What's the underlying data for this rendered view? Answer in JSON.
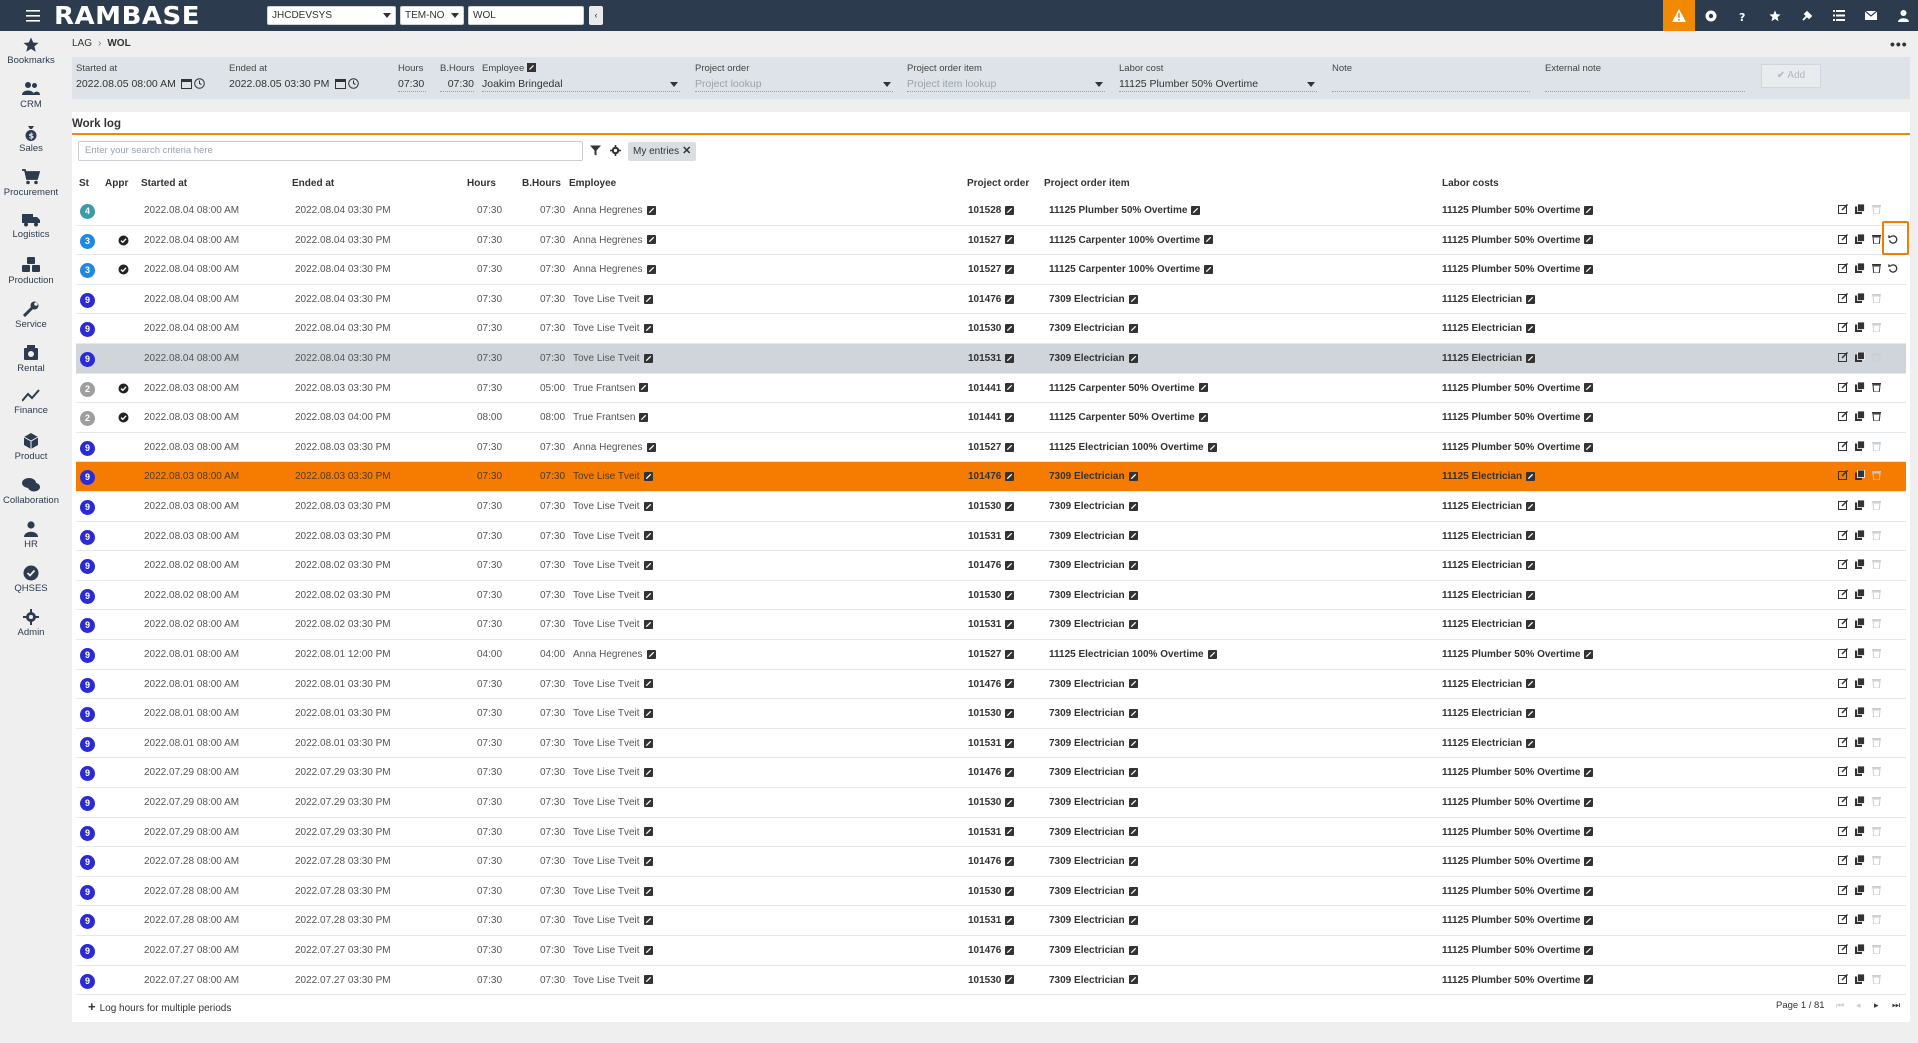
{
  "topbar": {
    "logo": "RAMBASE",
    "database": "JHCDEVSYS",
    "company": "TEM-NO",
    "search_value": "WOL",
    "icons": [
      "alert-icon",
      "support-icon",
      "help-icon",
      "star-icon",
      "pin-icon",
      "list-icon",
      "mail-icon",
      "user-icon"
    ],
    "accent": "#f18a00",
    "bar_color": "#2d3b4e"
  },
  "sidenav": [
    {
      "label": "Bookmarks",
      "icon": "star-icon"
    },
    {
      "label": "CRM",
      "icon": "people-icon"
    },
    {
      "label": "Sales",
      "icon": "moneybag-icon"
    },
    {
      "label": "Procurement",
      "icon": "cart-icon"
    },
    {
      "label": "Logistics",
      "icon": "truck-icon"
    },
    {
      "label": "Production",
      "icon": "boxes-icon"
    },
    {
      "label": "Service",
      "icon": "wrench-icon"
    },
    {
      "label": "Rental",
      "icon": "rental-icon"
    },
    {
      "label": "Finance",
      "icon": "chart-icon"
    },
    {
      "label": "Product",
      "icon": "cube-icon"
    },
    {
      "label": "Collaboration",
      "icon": "chat-icon"
    },
    {
      "label": "HR",
      "icon": "person-icon"
    },
    {
      "label": "QHSES",
      "icon": "check-badge-icon"
    },
    {
      "label": "Admin",
      "icon": "gear-icon"
    }
  ],
  "breadcrumb": {
    "root": "LAG",
    "current": "WOL"
  },
  "entry": {
    "started_label": "Started at",
    "started_value": "2022.08.05 08:00 AM",
    "ended_label": "Ended at",
    "ended_value": "2022.08.05 03:30 PM",
    "hours_label": "Hours",
    "hours_value": "07:30",
    "bhours_label": "B.Hours",
    "bhours_value": "07:30",
    "employee_label": "Employee",
    "employee_value": "Joakim Bringedal",
    "project_order_label": "Project order",
    "project_order_placeholder": "Project lookup",
    "project_item_label": "Project order item",
    "project_item_placeholder": "Project item lookup",
    "labor_label": "Labor cost",
    "labor_value": "11125 Plumber 50% Overtime",
    "note_label": "Note",
    "ext_note_label": "External note",
    "add_label": "✔ Add"
  },
  "worklog": {
    "title": "Work log",
    "search_placeholder": "Enter your search criteria here",
    "chip_label": "My entries",
    "columns": {
      "st": "St",
      "appr": "Appr",
      "started": "Started at",
      "ended": "Ended at",
      "hours": "Hours",
      "bhours": "B.Hours",
      "employee": "Employee",
      "project_order": "Project order",
      "project_item": "Project order item",
      "labor": "Labor costs"
    },
    "rows": [
      {
        "st": "4",
        "appr": false,
        "started": "2022.08.04 08:00 AM",
        "ended": "2022.08.04 03:30 PM",
        "hours": "07:30",
        "bhours": "07:30",
        "employee": "Anna Hegrenes",
        "po": "101528",
        "item": "11125 Plumber 50% Overtime",
        "labor": "11125 Plumber 50% Overtime",
        "del": false,
        "undo": false,
        "style": ""
      },
      {
        "st": "3",
        "appr": true,
        "started": "2022.08.04 08:00 AM",
        "ended": "2022.08.04 03:30 PM",
        "hours": "07:30",
        "bhours": "07:30",
        "employee": "Anna Hegrenes",
        "po": "101527",
        "item": "11125 Carpenter 100% Overtime",
        "labor": "11125 Plumber 50% Overtime",
        "del": true,
        "undo": true,
        "style": ""
      },
      {
        "st": "3",
        "appr": true,
        "started": "2022.08.04 08:00 AM",
        "ended": "2022.08.04 03:30 PM",
        "hours": "07:30",
        "bhours": "07:30",
        "employee": "Anna Hegrenes",
        "po": "101527",
        "item": "11125 Carpenter 100% Overtime",
        "labor": "11125 Plumber 50% Overtime",
        "del": true,
        "undo": true,
        "style": ""
      },
      {
        "st": "9",
        "appr": false,
        "started": "2022.08.04 08:00 AM",
        "ended": "2022.08.04 03:30 PM",
        "hours": "07:30",
        "bhours": "07:30",
        "employee": "Tove Lise Tveit",
        "po": "101476",
        "item": "7309 Electrician",
        "labor": "11125 Electrician",
        "del": false,
        "undo": false,
        "style": ""
      },
      {
        "st": "9",
        "appr": false,
        "started": "2022.08.04 08:00 AM",
        "ended": "2022.08.04 03:30 PM",
        "hours": "07:30",
        "bhours": "07:30",
        "employee": "Tove Lise Tveit",
        "po": "101530",
        "item": "7309 Electrician",
        "labor": "11125 Electrician",
        "del": false,
        "undo": false,
        "style": ""
      },
      {
        "st": "9",
        "appr": false,
        "started": "2022.08.04 08:00 AM",
        "ended": "2022.08.04 03:30 PM",
        "hours": "07:30",
        "bhours": "07:30",
        "employee": "Tove Lise Tveit",
        "po": "101531",
        "item": "7309 Electrician",
        "labor": "11125 Electrician",
        "del": false,
        "undo": false,
        "style": "grey"
      },
      {
        "st": "2",
        "appr": true,
        "started": "2022.08.03 08:00 AM",
        "ended": "2022.08.03 03:30 PM",
        "hours": "07:30",
        "bhours": "05:00",
        "employee": "True Frantsen",
        "po": "101441",
        "item": "11125 Carpenter 50% Overtime",
        "labor": "11125 Plumber 50% Overtime",
        "del": true,
        "undo": false,
        "style": ""
      },
      {
        "st": "2",
        "appr": true,
        "started": "2022.08.03 08:00 AM",
        "ended": "2022.08.03 04:00 PM",
        "hours": "08:00",
        "bhours": "08:00",
        "employee": "True Frantsen",
        "po": "101441",
        "item": "11125 Carpenter 50% Overtime",
        "labor": "11125 Plumber 50% Overtime",
        "del": true,
        "undo": false,
        "style": ""
      },
      {
        "st": "9",
        "appr": false,
        "started": "2022.08.03 08:00 AM",
        "ended": "2022.08.03 03:30 PM",
        "hours": "07:30",
        "bhours": "07:30",
        "employee": "Anna Hegrenes",
        "po": "101527",
        "item": "11125 Electrician 100% Overtime",
        "labor": "11125 Plumber 50% Overtime",
        "del": false,
        "undo": false,
        "style": ""
      },
      {
        "st": "9",
        "appr": false,
        "started": "2022.08.03 08:00 AM",
        "ended": "2022.08.03 03:30 PM",
        "hours": "07:30",
        "bhours": "07:30",
        "employee": "Tove Lise Tveit",
        "po": "101476",
        "item": "7309 Electrician",
        "labor": "11125 Electrician",
        "del": false,
        "undo": false,
        "style": "orange"
      },
      {
        "st": "9",
        "appr": false,
        "started": "2022.08.03 08:00 AM",
        "ended": "2022.08.03 03:30 PM",
        "hours": "07:30",
        "bhours": "07:30",
        "employee": "Tove Lise Tveit",
        "po": "101530",
        "item": "7309 Electrician",
        "labor": "11125 Electrician",
        "del": false,
        "undo": false,
        "style": ""
      },
      {
        "st": "9",
        "appr": false,
        "started": "2022.08.03 08:00 AM",
        "ended": "2022.08.03 03:30 PM",
        "hours": "07:30",
        "bhours": "07:30",
        "employee": "Tove Lise Tveit",
        "po": "101531",
        "item": "7309 Electrician",
        "labor": "11125 Electrician",
        "del": false,
        "undo": false,
        "style": ""
      },
      {
        "st": "9",
        "appr": false,
        "started": "2022.08.02 08:00 AM",
        "ended": "2022.08.02 03:30 PM",
        "hours": "07:30",
        "bhours": "07:30",
        "employee": "Tove Lise Tveit",
        "po": "101476",
        "item": "7309 Electrician",
        "labor": "11125 Electrician",
        "del": false,
        "undo": false,
        "style": ""
      },
      {
        "st": "9",
        "appr": false,
        "started": "2022.08.02 08:00 AM",
        "ended": "2022.08.02 03:30 PM",
        "hours": "07:30",
        "bhours": "07:30",
        "employee": "Tove Lise Tveit",
        "po": "101530",
        "item": "7309 Electrician",
        "labor": "11125 Electrician",
        "del": false,
        "undo": false,
        "style": ""
      },
      {
        "st": "9",
        "appr": false,
        "started": "2022.08.02 08:00 AM",
        "ended": "2022.08.02 03:30 PM",
        "hours": "07:30",
        "bhours": "07:30",
        "employee": "Tove Lise Tveit",
        "po": "101531",
        "item": "7309 Electrician",
        "labor": "11125 Electrician",
        "del": false,
        "undo": false,
        "style": ""
      },
      {
        "st": "9",
        "appr": false,
        "started": "2022.08.01 08:00 AM",
        "ended": "2022.08.01 12:00 PM",
        "hours": "04:00",
        "bhours": "04:00",
        "employee": "Anna Hegrenes",
        "po": "101527",
        "item": "11125 Electrician 100% Overtime",
        "labor": "11125 Plumber 50% Overtime",
        "del": false,
        "undo": false,
        "style": ""
      },
      {
        "st": "9",
        "appr": false,
        "started": "2022.08.01 08:00 AM",
        "ended": "2022.08.01 03:30 PM",
        "hours": "07:30",
        "bhours": "07:30",
        "employee": "Tove Lise Tveit",
        "po": "101476",
        "item": "7309 Electrician",
        "labor": "11125 Electrician",
        "del": false,
        "undo": false,
        "style": ""
      },
      {
        "st": "9",
        "appr": false,
        "started": "2022.08.01 08:00 AM",
        "ended": "2022.08.01 03:30 PM",
        "hours": "07:30",
        "bhours": "07:30",
        "employee": "Tove Lise Tveit",
        "po": "101530",
        "item": "7309 Electrician",
        "labor": "11125 Electrician",
        "del": false,
        "undo": false,
        "style": ""
      },
      {
        "st": "9",
        "appr": false,
        "started": "2022.08.01 08:00 AM",
        "ended": "2022.08.01 03:30 PM",
        "hours": "07:30",
        "bhours": "07:30",
        "employee": "Tove Lise Tveit",
        "po": "101531",
        "item": "7309 Electrician",
        "labor": "11125 Electrician",
        "del": false,
        "undo": false,
        "style": ""
      },
      {
        "st": "9",
        "appr": false,
        "started": "2022.07.29 08:00 AM",
        "ended": "2022.07.29 03:30 PM",
        "hours": "07:30",
        "bhours": "07:30",
        "employee": "Tove Lise Tveit",
        "po": "101476",
        "item": "7309 Electrician",
        "labor": "11125 Plumber 50% Overtime",
        "del": false,
        "undo": false,
        "style": ""
      },
      {
        "st": "9",
        "appr": false,
        "started": "2022.07.29 08:00 AM",
        "ended": "2022.07.29 03:30 PM",
        "hours": "07:30",
        "bhours": "07:30",
        "employee": "Tove Lise Tveit",
        "po": "101530",
        "item": "7309 Electrician",
        "labor": "11125 Plumber 50% Overtime",
        "del": false,
        "undo": false,
        "style": ""
      },
      {
        "st": "9",
        "appr": false,
        "started": "2022.07.29 08:00 AM",
        "ended": "2022.07.29 03:30 PM",
        "hours": "07:30",
        "bhours": "07:30",
        "employee": "Tove Lise Tveit",
        "po": "101531",
        "item": "7309 Electrician",
        "labor": "11125 Plumber 50% Overtime",
        "del": false,
        "undo": false,
        "style": ""
      },
      {
        "st": "9",
        "appr": false,
        "started": "2022.07.28 08:00 AM",
        "ended": "2022.07.28 03:30 PM",
        "hours": "07:30",
        "bhours": "07:30",
        "employee": "Tove Lise Tveit",
        "po": "101476",
        "item": "7309 Electrician",
        "labor": "11125 Plumber 50% Overtime",
        "del": false,
        "undo": false,
        "style": ""
      },
      {
        "st": "9",
        "appr": false,
        "started": "2022.07.28 08:00 AM",
        "ended": "2022.07.28 03:30 PM",
        "hours": "07:30",
        "bhours": "07:30",
        "employee": "Tove Lise Tveit",
        "po": "101530",
        "item": "7309 Electrician",
        "labor": "11125 Plumber 50% Overtime",
        "del": false,
        "undo": false,
        "style": ""
      },
      {
        "st": "9",
        "appr": false,
        "started": "2022.07.28 08:00 AM",
        "ended": "2022.07.28 03:30 PM",
        "hours": "07:30",
        "bhours": "07:30",
        "employee": "Tove Lise Tveit",
        "po": "101531",
        "item": "7309 Electrician",
        "labor": "11125 Plumber 50% Overtime",
        "del": false,
        "undo": false,
        "style": ""
      },
      {
        "st": "9",
        "appr": false,
        "started": "2022.07.27 08:00 AM",
        "ended": "2022.07.27 03:30 PM",
        "hours": "07:30",
        "bhours": "07:30",
        "employee": "Tove Lise Tveit",
        "po": "101476",
        "item": "7309 Electrician",
        "labor": "11125 Plumber 50% Overtime",
        "del": false,
        "undo": false,
        "style": ""
      },
      {
        "st": "9",
        "appr": false,
        "started": "2022.07.27 08:00 AM",
        "ended": "2022.07.27 03:30 PM",
        "hours": "07:30",
        "bhours": "07:30",
        "employee": "Tove Lise Tveit",
        "po": "101530",
        "item": "7309 Electrician",
        "labor": "11125 Plumber 50% Overtime",
        "del": false,
        "undo": false,
        "style": ""
      }
    ],
    "status_colors": {
      "4": "#3d9aa8",
      "3": "#1e88e5",
      "2": "#9e9e9e",
      "9": "#2b2bd6"
    },
    "footer": {
      "log_multiple": "Log hours for multiple periods",
      "pager": "Page 1 / 81"
    }
  }
}
